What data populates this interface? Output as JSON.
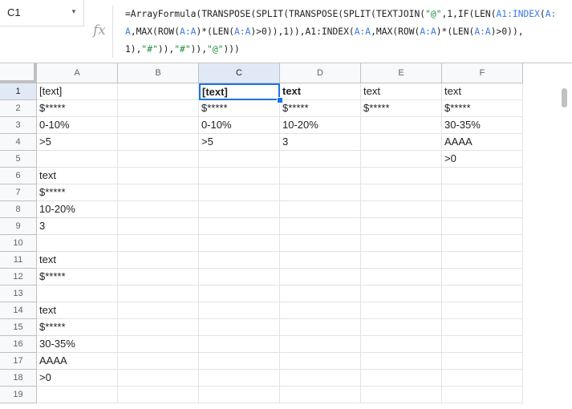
{
  "name_box": {
    "value": "C1"
  },
  "formula_bar": {
    "fx_label": "fx",
    "segments": [
      {
        "t": "=ArrayFormula(TRANSPOSE(SPLIT(TRANSPOSE(SPLIT(TEXTJOIN(",
        "c": ""
      },
      {
        "t": "\"@\"",
        "c": "str"
      },
      {
        "t": ",1,IF(LEN(",
        "c": ""
      },
      {
        "t": "A1:INDEX",
        "c": "ref"
      },
      {
        "t": "(",
        "c": ""
      },
      {
        "t": "A:A",
        "c": "ref"
      },
      {
        "t": ",MAX(ROW(",
        "c": ""
      },
      {
        "t": "A:A",
        "c": "ref"
      },
      {
        "t": ")*(LEN(",
        "c": ""
      },
      {
        "t": "A:A",
        "c": "ref"
      },
      {
        "t": ")>0)),1)),",
        "c": ""
      },
      {
        "t": "A1:INDEX(",
        "c": ""
      },
      {
        "t": "A:A",
        "c": "ref"
      },
      {
        "t": ",MAX(ROW(",
        "c": ""
      },
      {
        "t": "A:A",
        "c": "ref"
      },
      {
        "t": ")*(LEN(",
        "c": ""
      },
      {
        "t": "A:A",
        "c": "ref"
      },
      {
        "t": ")>0)),",
        "c": ""
      },
      {
        "t": "1),",
        "c": ""
      },
      {
        "t": "\"#\"",
        "c": "str"
      },
      {
        "t": ")),",
        "c": ""
      },
      {
        "t": "\"#\"",
        "c": "str"
      },
      {
        "t": ")),",
        "c": ""
      },
      {
        "t": "\"@\"",
        "c": "str"
      },
      {
        "t": ")))",
        "c": ""
      }
    ]
  },
  "columns": [
    "A",
    "B",
    "C",
    "D",
    "E",
    "F"
  ],
  "rows": [
    "1",
    "2",
    "3",
    "4",
    "5",
    "6",
    "7",
    "8",
    "9",
    "10",
    "11",
    "12",
    "13",
    "14",
    "15",
    "16",
    "17",
    "18",
    "19"
  ],
  "selected_column": "C",
  "selected_row": "1",
  "cells": {
    "A": [
      "[text]",
      "$*****",
      "0-10%",
      ">5",
      "",
      "text",
      "$*****",
      "10-20%",
      "3",
      "",
      "text",
      "$*****",
      "",
      "text",
      "$*****",
      "30-35%",
      "AAAA",
      ">0",
      ""
    ],
    "B": [
      "",
      "",
      "",
      "",
      "",
      "",
      "",
      "",
      "",
      "",
      "",
      "",
      "",
      "",
      "",
      "",
      "",
      "",
      ""
    ],
    "C": [
      "[text]",
      "$*****",
      "0-10%",
      ">5",
      "",
      "",
      "",
      "",
      "",
      "",
      "",
      "",
      "",
      "",
      "",
      "",
      "",
      "",
      ""
    ],
    "D": [
      "text",
      "$*****",
      "10-20%",
      "3",
      "",
      "",
      "",
      "",
      "",
      "",
      "",
      "",
      "",
      "",
      "",
      "",
      "",
      "",
      ""
    ],
    "E": [
      "text",
      "$*****",
      "",
      "",
      "",
      "",
      "",
      "",
      "",
      "",
      "",
      "",
      "",
      "",
      "",
      "",
      "",
      "",
      ""
    ],
    "F": [
      "text",
      "$*****",
      "30-35%",
      "AAAA",
      ">0",
      "",
      "",
      "",
      "",
      "",
      "",
      "",
      "",
      "",
      "",
      "",
      "",
      "",
      ""
    ]
  },
  "bold_cells": [
    "C1",
    "D1"
  ],
  "active_cell": "C1",
  "colors": {
    "accent": "#1a73e8",
    "header_bg": "#f8f9fa",
    "header_selected_bg": "#e1e9f7"
  }
}
